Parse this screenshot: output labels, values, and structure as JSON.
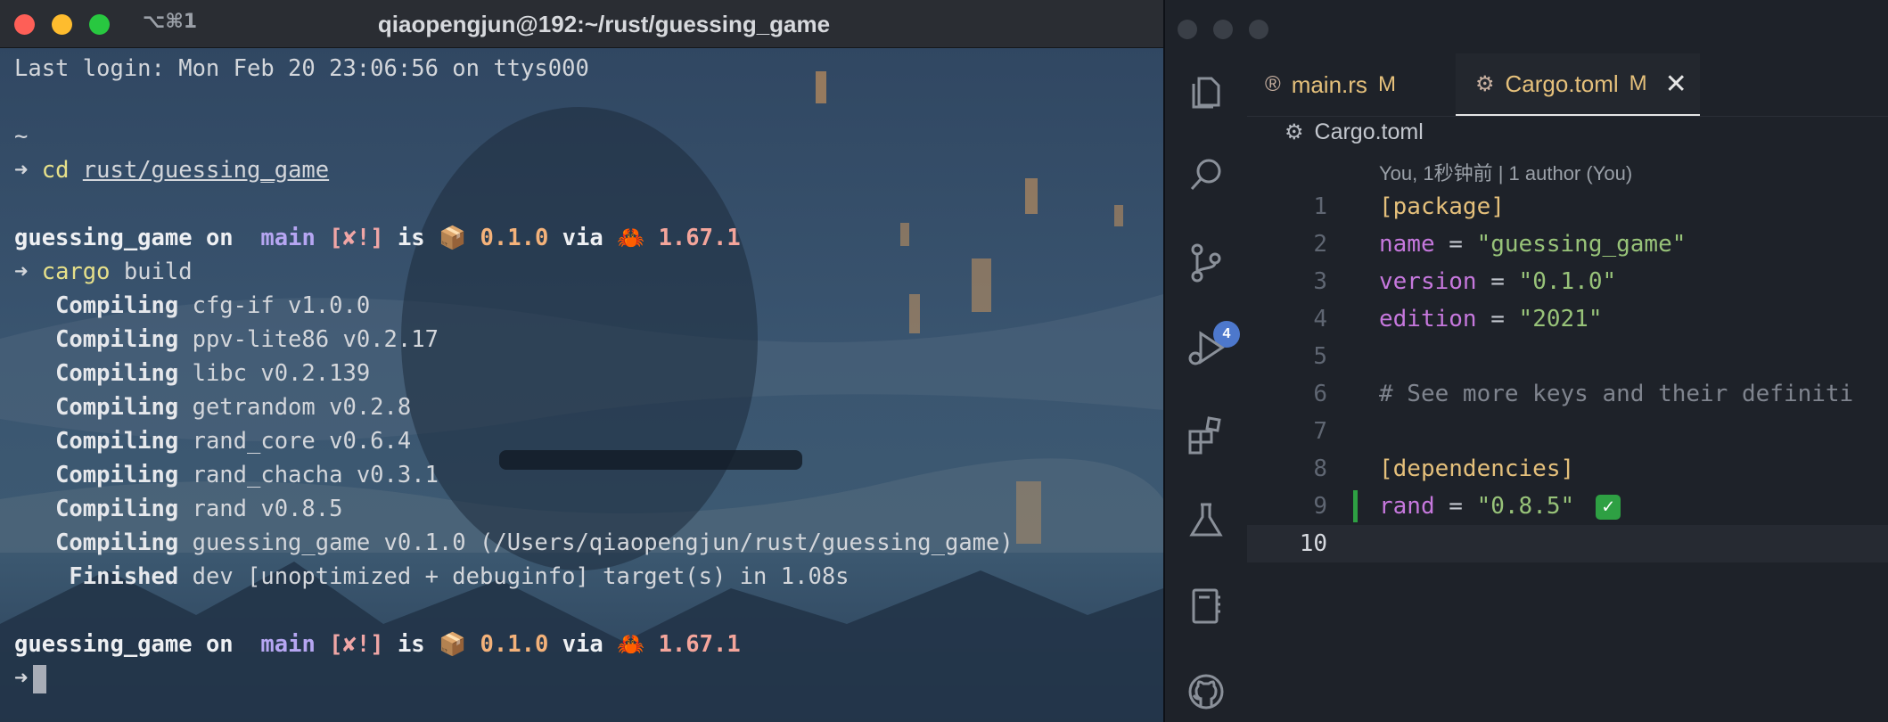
{
  "terminal": {
    "shortcut": "⌥⌘1",
    "title": "qiaopengjun@192:~/rust/guessing_game",
    "last_login": "Last login: Mon Feb 20 23:06:56 on ttys000",
    "tilde": "~",
    "arrow": "➜",
    "cd_cmd": "cd",
    "cd_path": "rust/guessing_game",
    "prompt": {
      "dir": "guessing_game",
      "on": "on",
      "branch_icon": "",
      "branch": "main",
      "status": "[✘!]",
      "is": "is",
      "pkg_emoji": "📦",
      "pkg_version": "0.1.0",
      "via": "via",
      "rust_emoji": "🦀",
      "rust_version": "1.67.1"
    },
    "build_cmd": "cargo",
    "build_arg": "build",
    "compile_label": "Compiling",
    "compile_lines": [
      "cfg-if v1.0.0",
      "ppv-lite86 v0.2.17",
      "libc v0.2.139",
      "getrandom v0.2.8",
      "rand_core v0.6.4",
      "rand_chacha v0.3.1",
      "rand v0.8.5",
      "guessing_game v0.1.0 (/Users/qiaopengjun/rust/guessing_game)"
    ],
    "finished_label": "Finished",
    "finished_text": "dev [unoptimized + debuginfo] target(s) in 1.08s"
  },
  "editor": {
    "scm_badge": "4",
    "tabs": [
      {
        "label": "main.rs",
        "modified": "M"
      },
      {
        "label": "Cargo.toml",
        "modified": "M",
        "close": "✕"
      }
    ],
    "breadcrumb": "Cargo.toml",
    "blame": "You, 1秒钟前 | 1 author (You)",
    "lines": [
      {
        "n": "1",
        "parts": [
          [
            "k-sec",
            "[package]"
          ]
        ]
      },
      {
        "n": "2",
        "parts": [
          [
            "k-key",
            "name"
          ],
          [
            "k-eq",
            " = "
          ],
          [
            "k-str",
            "\"guessing_game\""
          ]
        ]
      },
      {
        "n": "3",
        "parts": [
          [
            "k-key",
            "version"
          ],
          [
            "k-eq",
            " = "
          ],
          [
            "k-str",
            "\"0.1.0\""
          ]
        ]
      },
      {
        "n": "4",
        "parts": [
          [
            "k-key",
            "edition"
          ],
          [
            "k-eq",
            " = "
          ],
          [
            "k-str",
            "\"2021\""
          ]
        ]
      },
      {
        "n": "5",
        "parts": []
      },
      {
        "n": "6",
        "parts": [
          [
            "k-com",
            "# See more keys and their definiti"
          ]
        ]
      },
      {
        "n": "7",
        "parts": []
      },
      {
        "n": "8",
        "parts": [
          [
            "k-sec",
            "[dependencies]"
          ]
        ]
      },
      {
        "n": "9",
        "parts": [
          [
            "k-key",
            "rand"
          ],
          [
            "k-eq",
            " = "
          ],
          [
            "k-str",
            "\"0.8.5\""
          ]
        ],
        "check": "✓"
      },
      {
        "n": "10",
        "parts": [],
        "active": true
      }
    ]
  }
}
